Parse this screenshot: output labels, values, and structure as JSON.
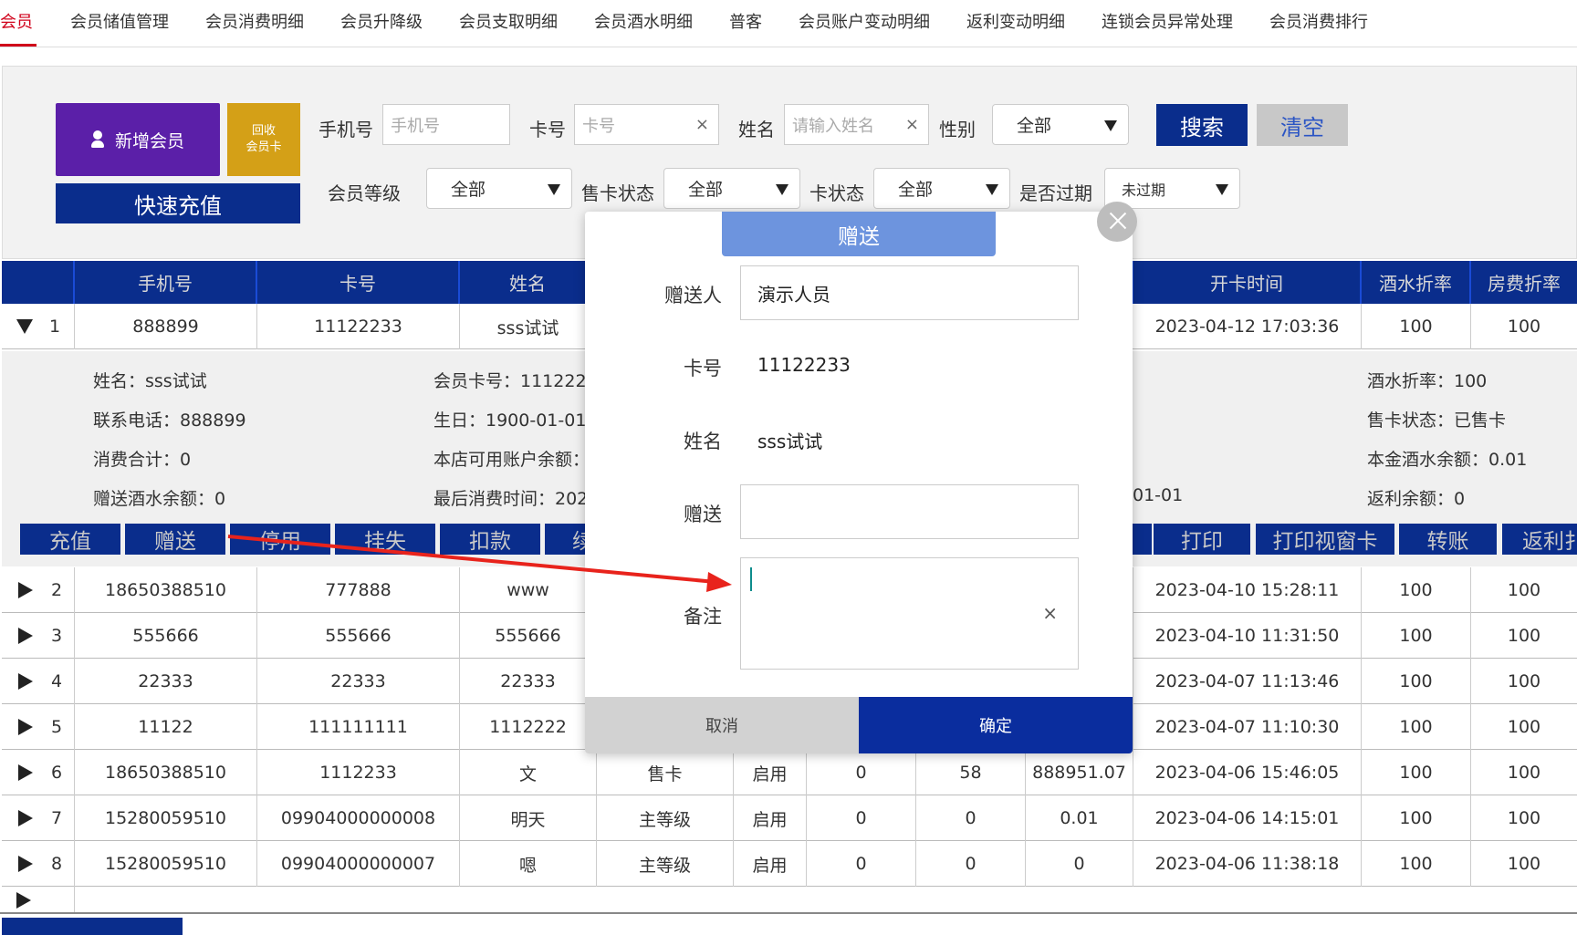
{
  "tabs": [
    "会员",
    "会员储值管理",
    "会员消费明细",
    "会员升降级",
    "会员支取明细",
    "会员酒水明细",
    "普客",
    "会员账户变动明细",
    "返利变动明细",
    "连锁会员异常处理",
    "会员消费排行"
  ],
  "filters": {
    "add_member": "新增会员",
    "recycle_line1": "回收",
    "recycle_line2": "会员卡",
    "quick_recharge": "快速充值",
    "phone_label": "手机号",
    "phone_placeholder": "手机号",
    "card_label": "卡号",
    "card_placeholder": "卡号",
    "name_label": "姓名",
    "name_placeholder": "请输入姓名",
    "gender_label": "性别",
    "gender_value": "全部",
    "search": "搜索",
    "clear": "清空",
    "level_label": "会员等级",
    "level_value": "全部",
    "sale_status_label": "售卡状态",
    "sale_status_value": "全部",
    "card_status_label": "卡状态",
    "card_status_value": "全部",
    "expired_label": "是否过期",
    "expired_value": "未过期",
    "clear_icon": "×"
  },
  "table": {
    "headers": [
      "手机号",
      "卡号",
      "姓名",
      "开卡时间",
      "酒水折率",
      "房费折率"
    ],
    "expanded_row": {
      "index": "1",
      "phone": "888899",
      "card": "11122233",
      "name": "sss试试",
      "open_time": "2023-04-12 17:03:36",
      "drink_rate": "100",
      "room_rate": "100"
    },
    "rows": [
      {
        "index": "2",
        "phone": "18650388510",
        "card": "777888",
        "name": "www",
        "c4": "",
        "c5": "",
        "c6": "",
        "c7": "",
        "c8": "",
        "open_time": "2023-04-10 15:28:11",
        "drink_rate": "100",
        "room_rate": "100"
      },
      {
        "index": "3",
        "phone": "555666",
        "card": "555666",
        "name": "555666",
        "c4": "",
        "c5": "",
        "c6": "",
        "c7": "",
        "c8": "",
        "open_time": "2023-04-10 11:31:50",
        "drink_rate": "100",
        "room_rate": "100"
      },
      {
        "index": "4",
        "phone": "22333",
        "card": "22333",
        "name": "22333",
        "c4": "",
        "c5": "",
        "c6": "",
        "c7": "",
        "c8": "",
        "open_time": "2023-04-07 11:13:46",
        "drink_rate": "100",
        "room_rate": "100"
      },
      {
        "index": "5",
        "phone": "11122",
        "card": "111111111",
        "name": "1112222",
        "c4": "",
        "c5": "",
        "c6": "",
        "c7": "",
        "c8": "",
        "open_time": "2023-04-07 11:10:30",
        "drink_rate": "100",
        "room_rate": "100"
      },
      {
        "index": "6",
        "phone": "18650388510",
        "card": "1112233",
        "name": "文",
        "c4": "售卡",
        "c5": "启用",
        "c6": "0",
        "c7": "58",
        "c8": "888951.07",
        "open_time": "2023-04-06 15:46:05",
        "drink_rate": "100",
        "room_rate": "100"
      },
      {
        "index": "7",
        "phone": "15280059510",
        "card": "09904000000008",
        "name": "明天",
        "c4": "主等级",
        "c5": "启用",
        "c6": "0",
        "c7": "0",
        "c8": "0.01",
        "open_time": "2023-04-06 14:15:01",
        "drink_rate": "100",
        "room_rate": "100"
      },
      {
        "index": "8",
        "phone": "15280059510",
        "card": "09904000000007",
        "name": "嗯",
        "c4": "主等级",
        "c5": "启用",
        "c6": "0",
        "c7": "0",
        "c8": "0",
        "open_time": "2023-04-06 11:38:18",
        "drink_rate": "100",
        "room_rate": "100"
      }
    ]
  },
  "detail": {
    "name": "姓名：sss试试",
    "phone": "联系电话：888899",
    "total_spent": "消费合计：0",
    "gift_drink_balance": "赠送酒水余额：0",
    "card_no": "会员卡号：111222",
    "birthday": "生日：1900-01-01",
    "store_balance": "本店可用账户余额：",
    "last_spent": "最后消费时间：202",
    "partial_date": "01-01",
    "drink_rate": "酒水折率：100",
    "sale_status": "售卡状态：已售卡",
    "principal_drink_balance": "本金酒水余额：0.01",
    "rebate_balance": "返利余额：0"
  },
  "actions": {
    "recharge": "充值",
    "gift": "赠送",
    "disable": "停用",
    "report_loss": "挂失",
    "deduct": "扣款",
    "partial": "续",
    "print": "打印",
    "print_window": "打印视窗卡",
    "transfer": "转账",
    "rebate": "返利扌"
  },
  "modal": {
    "title": "赠送",
    "giver_label": "赠送人",
    "giver_value": "演示人员",
    "card_label": "卡号",
    "card_value": "11122233",
    "name_label": "姓名",
    "name_value": "sss试试",
    "gift_label": "赠送",
    "gift_value": "",
    "remark_label": "备注",
    "cancel": "取消",
    "confirm": "确定",
    "clear_icon": "×"
  },
  "colors": {
    "accent_red": "#d0021b",
    "navy": "#0a2d8c",
    "purple": "#5b1fa8",
    "gold": "#d4a017",
    "modal_title": "#6d94de",
    "arrow": "#e8231c"
  },
  "icons": [
    "user-icon",
    "clear-icon",
    "chevron-down-icon",
    "expand-down-icon",
    "expand-right-icon",
    "close-icon",
    "annotation-arrow"
  ]
}
